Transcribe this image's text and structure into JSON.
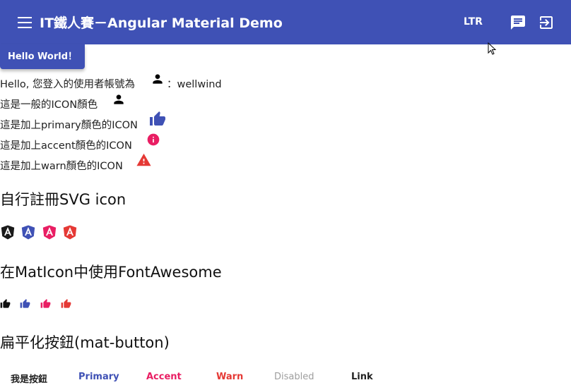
{
  "header": {
    "title": "IT鐵人賽－Angular Material Demo",
    "ltr_label": "LTR",
    "icons": {
      "menu": "menu-icon",
      "chat": "chat-icon",
      "exit": "exit-to-app-icon"
    }
  },
  "hello_button": {
    "label": "Hello World！"
  },
  "user_lines": {
    "hello_prefix": "Hello, 您登入的使用者帳號為",
    "hello_suffix": "：wellwind",
    "normal_color": "這是一般的ICON顏色",
    "primary_color": "這是加上primary顏色的ICON",
    "accent_color": "這是加上accent顏色的ICON",
    "warn_color": "這是加上warn顏色的ICON"
  },
  "sections": {
    "svg_icon_title": "自行註冊SVG icon",
    "fontawesome_title": "在MatIcon中使用FontAwesome",
    "flat_button_title": "扁平化按鈕(mat-button)"
  },
  "flat_buttons": {
    "basic": "我是按鈕",
    "primary": "Primary",
    "accent": "Accent",
    "warn": "Warn",
    "disabled": "Disabled",
    "link": "Link"
  },
  "colors": {
    "primary": "#3f51b5",
    "accent": "#e91e63",
    "warn": "#e53935",
    "disabled": "#9e9e9e",
    "text": "#212121"
  }
}
